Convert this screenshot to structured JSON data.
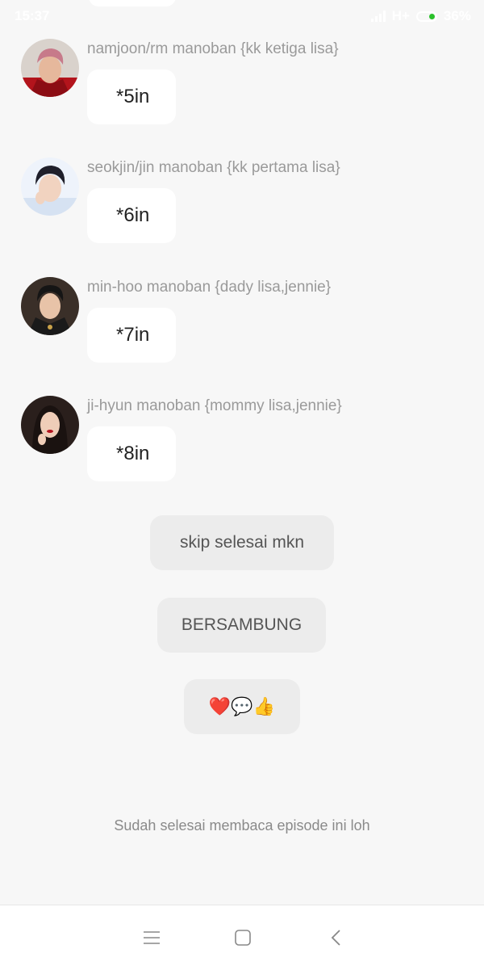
{
  "status_bar": {
    "time": "15:37",
    "network": "H+",
    "battery": "36%"
  },
  "messages": [
    {
      "sender": "namjoon/rm manoban {kk ketiga lisa}",
      "text": "*5in"
    },
    {
      "sender": "seokjin/jin manoban {kk pertama lisa}",
      "text": "*6in"
    },
    {
      "sender": "min-hoo manoban {dady lisa,jennie}",
      "text": "*7in"
    },
    {
      "sender": "ji-hyun manoban {mommy lisa,jennie}",
      "text": "*8in"
    }
  ],
  "actions": {
    "skip_label": "skip selesai mkn",
    "continue_label": "BERSAMBUNG",
    "reaction_label": "❤️💬👍"
  },
  "footer_note": "Sudah selesai membaca episode ini loh",
  "colors": {
    "background": "#f7f7f7",
    "bubble": "#ffffff",
    "button": "#ececec",
    "battery_accent": "#2bc12b"
  }
}
